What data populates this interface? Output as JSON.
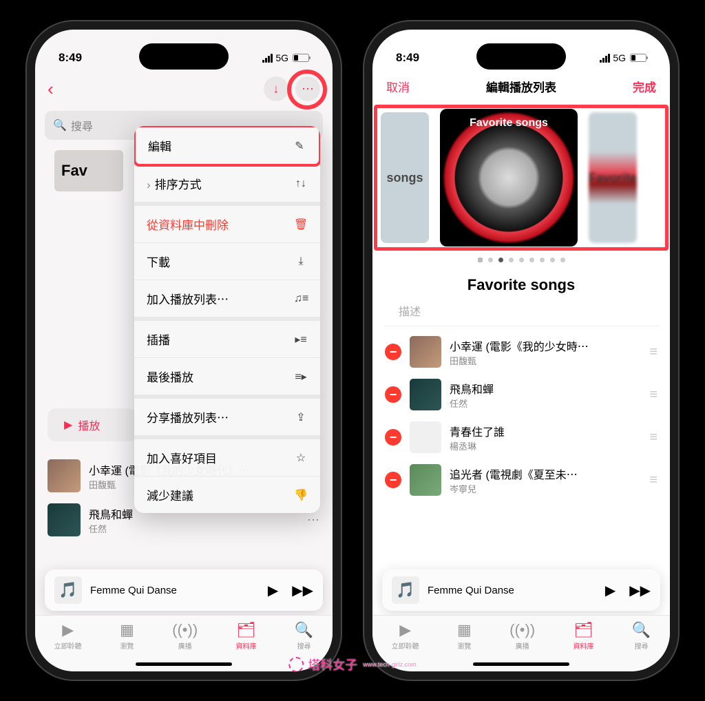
{
  "status": {
    "time": "8:49",
    "network": "5G"
  },
  "phone1": {
    "search_placeholder": "搜尋",
    "album_peek": "Fav",
    "menu": {
      "edit": "編輯",
      "sort": "排序方式",
      "delete": "從資料庫中刪除",
      "download": "下載",
      "add_playlist": "加入播放列表⋯",
      "play_next": "插播",
      "play_last": "最後播放",
      "share": "分享播放列表⋯",
      "favorite": "加入喜好項目",
      "less": "減少建議"
    },
    "play_button": "播放",
    "songs": [
      {
        "title": "小幸運 (電影《我的少女時代》⋯",
        "artist": "田馥甄"
      },
      {
        "title": "飛鳥和蟬",
        "artist": "任然"
      }
    ]
  },
  "phone2": {
    "cancel": "取消",
    "title": "編輯播放列表",
    "done": "完成",
    "cover_left": "songs",
    "cover_main": "Favorite songs",
    "cover_right": "Favorite",
    "playlist_name": "Favorite songs",
    "desc_label": "描述",
    "songs": [
      {
        "title": "小幸運 (電影《我的少女時⋯",
        "artist": "田馥甄"
      },
      {
        "title": "飛鳥和蟬",
        "artist": "任然"
      },
      {
        "title": "青春住了誰",
        "artist": "楊丞琳"
      },
      {
        "title": "追光者 (電視劇《夏至未⋯",
        "artist": "岑寧兒"
      }
    ]
  },
  "mini_player": {
    "title": "Femme Qui Danse"
  },
  "tabs": {
    "listen": "立即聆聽",
    "browse": "瀏覽",
    "radio": "廣播",
    "library": "資料庫",
    "search": "搜尋"
  },
  "watermark": {
    "text": "塔科女子",
    "url": "www.tech-girlz.com"
  }
}
